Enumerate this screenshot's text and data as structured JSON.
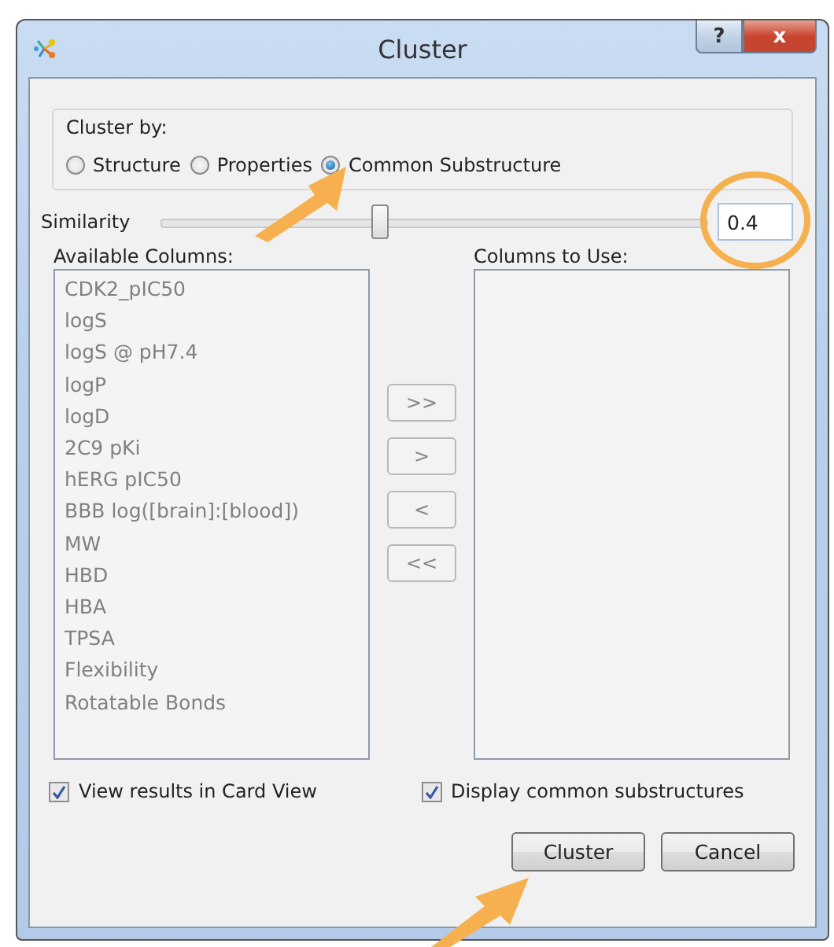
{
  "window": {
    "title": "Cluster",
    "help_button": "?",
    "close_button": "x"
  },
  "cluster_by": {
    "label": "Cluster by:",
    "options": [
      {
        "label": "Structure",
        "selected": false
      },
      {
        "label": "Properties",
        "selected": false
      },
      {
        "label": "Common Substructure",
        "selected": true
      }
    ]
  },
  "similarity": {
    "label": "Similarity",
    "level": 0.4,
    "value": "0.4"
  },
  "available_columns": {
    "label": "Available Columns:",
    "items": [
      "CDK2_pIC50",
      "logS",
      "logS @ pH7.4",
      "logP",
      "logD",
      "2C9 pKi",
      "hERG pIC50",
      "BBB log([brain]:[blood])",
      "MW",
      "HBD",
      "HBA",
      "TPSA",
      "Flexibility",
      "Rotatable Bonds"
    ]
  },
  "transfer_buttons": [
    ">>",
    ">",
    "<",
    "<<"
  ],
  "columns_to_use": {
    "label": "Columns to Use:"
  },
  "options": [
    {
      "label": "View results in Card View",
      "checked": true
    },
    {
      "label": "Display common substructures",
      "checked": true
    }
  ],
  "buttons": [
    "Cluster",
    "Cancel"
  ]
}
